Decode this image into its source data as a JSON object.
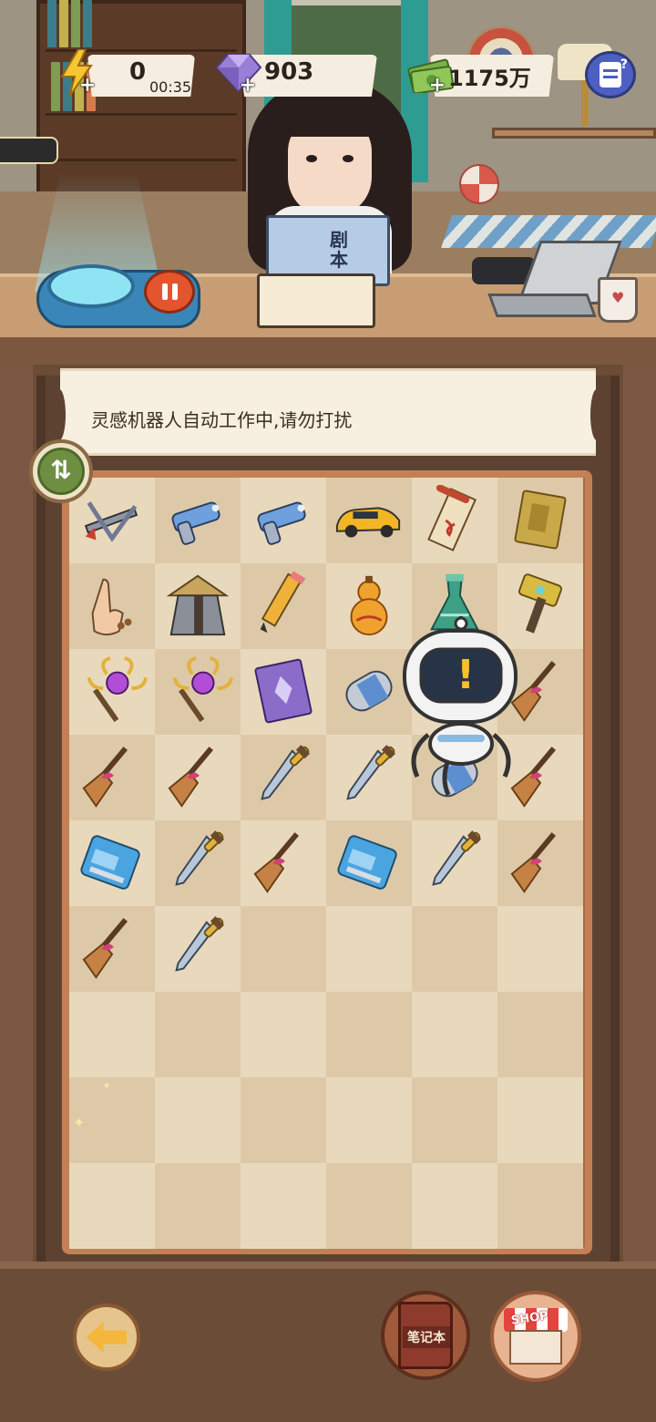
{
  "hud": {
    "energy_value": "0",
    "energy_timer": "00:35",
    "gems_value": "903",
    "cash_value": "1175万",
    "plus_label": "+"
  },
  "scene": {
    "book_title": "剧本"
  },
  "notice": {
    "text": "灵感机器人自动工作中,请勿打扰"
  },
  "board": {
    "columns": 6,
    "rows": 9,
    "cells": [
      [
        "crossbow",
        "blaster",
        "blaster",
        "sports-car",
        "scroll",
        "golden-book"
      ],
      [
        "buddha-hand",
        "straw-hat-cloak",
        "pencil",
        "gourd",
        "potion-bottle",
        "golden-hammer"
      ],
      [
        "magic-staff",
        "magic-staff",
        "magic-tome",
        "capsule",
        "robot",
        "broom"
      ],
      [
        "broom",
        "broom",
        "dagger",
        "dagger",
        "capsule",
        "broom"
      ],
      [
        "memory-card",
        "dagger",
        "broom",
        "memory-card",
        "dagger",
        "broom"
      ],
      [
        "broom",
        "dagger",
        "",
        "",
        "",
        ""
      ],
      [
        "",
        "",
        "",
        "",
        "",
        ""
      ],
      [
        "",
        "",
        "",
        "",
        "",
        ""
      ],
      [
        "",
        "",
        "",
        "",
        "",
        ""
      ]
    ]
  },
  "robot": {
    "alert_symbol": "!"
  },
  "buttons": {
    "swap_symbol": "⇅",
    "notebook_label": "笔记本",
    "shop_label": "SHOP"
  },
  "icons": {
    "energy": "lightning-icon",
    "gems": "gem-icon",
    "cash": "cash-icon",
    "menu": "quest-log-icon",
    "back": "back-arrow-icon"
  },
  "colors": {
    "board_frame": "#c48054",
    "board_light": "#e9d9bc",
    "board_dark": "#ddc9a8",
    "pause_red": "#e4552e",
    "menu_blue": "#4d5fc2"
  }
}
